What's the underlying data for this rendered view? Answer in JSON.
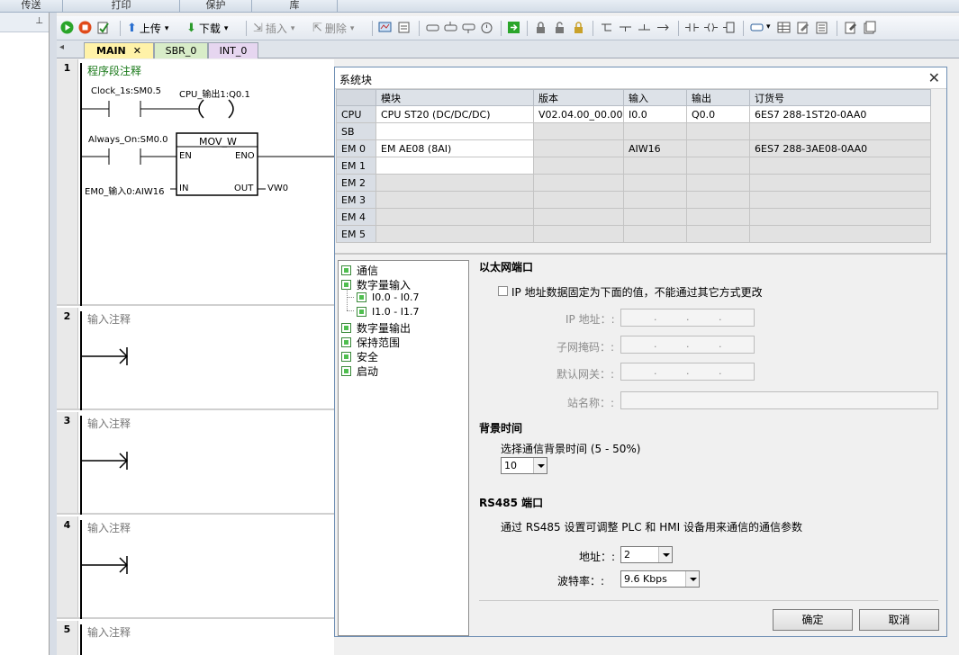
{
  "ribbon": {
    "items": [
      "传送",
      "打印",
      "保护",
      "库"
    ]
  },
  "left_pane": {
    "pin_glyph": "⊥"
  },
  "toolbar": {
    "upload": "上传",
    "download": "下载",
    "insert": "插入",
    "delete": "删除"
  },
  "tabs": [
    {
      "label": "MAIN",
      "close": "✕"
    },
    {
      "label": "SBR_0"
    },
    {
      "label": "INT_0"
    }
  ],
  "ladder": {
    "networks": [
      {
        "num": "1",
        "comment": "程序段注释"
      },
      {
        "num": "2",
        "comment": "输入注释"
      },
      {
        "num": "3",
        "comment": "输入注释"
      },
      {
        "num": "4",
        "comment": "输入注释"
      },
      {
        "num": "5",
        "comment": "输入注释"
      }
    ],
    "n1": {
      "contact1": "Clock_1s:SM0.5",
      "coil1": "CPU_输出1:Q0.1",
      "contact2": "Always_On:SM0.0",
      "box_name": "MOV_W",
      "en": "EN",
      "eno": "ENO",
      "in_pin": "IN",
      "out_pin": "OUT",
      "in_var": "EM0_输入0:AIW16",
      "out_var": "VW0"
    }
  },
  "dialog": {
    "title": "系统块",
    "close": "✕",
    "table": {
      "headers": [
        "模块",
        "版本",
        "输入",
        "输出",
        "订货号"
      ],
      "rows": [
        {
          "slot": "CPU",
          "module": "CPU ST20 (DC/DC/DC)",
          "version": "V02.04.00_00.00...",
          "input": "I0.0",
          "output": "Q0.0",
          "order": "6ES7 288-1ST20-0AA0"
        },
        {
          "slot": "SB",
          "module": "",
          "version": "",
          "input": "",
          "output": "",
          "order": ""
        },
        {
          "slot": "EM 0",
          "module": "EM AE08 (8AI)",
          "version": "",
          "input": "AIW16",
          "output": "",
          "order": "6ES7 288-3AE08-0AA0"
        },
        {
          "slot": "EM 1",
          "module": "",
          "version": "",
          "input": "",
          "output": "",
          "order": ""
        },
        {
          "slot": "EM 2",
          "module": "",
          "version": "",
          "input": "",
          "output": "",
          "order": ""
        },
        {
          "slot": "EM 3",
          "module": "",
          "version": "",
          "input": "",
          "output": "",
          "order": ""
        },
        {
          "slot": "EM 4",
          "module": "",
          "version": "",
          "input": "",
          "output": "",
          "order": ""
        },
        {
          "slot": "EM 5",
          "module": "",
          "version": "",
          "input": "",
          "output": "",
          "order": ""
        }
      ]
    },
    "tree": {
      "comm": "通信",
      "di": "数字量输入",
      "di_1": "I0.0 - I0.7",
      "di_2": "I1.0 - I1.7",
      "dq": "数字量输出",
      "retain": "保持范围",
      "security": "安全",
      "startup": "启动"
    },
    "ethernet": {
      "section": "以太网端口",
      "fixed_ip": "IP 地址数据固定为下面的值，不能通过其它方式更改",
      "ip": "IP 地址：:",
      "subnet": "子网掩码：:",
      "gateway": "默认网关：:",
      "station": "站名称：:",
      "dot": "."
    },
    "background": {
      "section": "背景时间",
      "desc": "选择通信背景时间 (5 - 50%)",
      "value": "10"
    },
    "rs485": {
      "section": "RS485 端口",
      "desc": "通过 RS485 设置可调整 PLC 和 HMI 设备用来通信的通信参数",
      "address_label": "地址：:",
      "address_value": "2",
      "baud_label": "波特率：:",
      "baud_value": "9.6 Kbps"
    },
    "ok": "确定",
    "cancel": "取消"
  }
}
